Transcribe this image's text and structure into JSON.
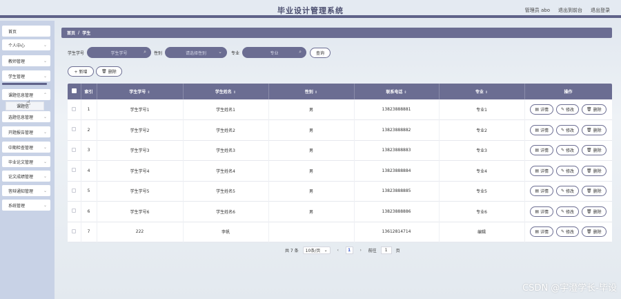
{
  "header": {
    "title": "毕业设计管理系统",
    "links": [
      "管理员 abo",
      "退出到前台",
      "退出登录"
    ]
  },
  "sidebar": {
    "items": [
      {
        "label": "首页",
        "chevron": false
      },
      {
        "label": "个人中心",
        "chevron": true
      },
      {
        "label": "教师管理",
        "chevron": true
      },
      {
        "label": "学生管理",
        "chevron": true
      },
      {
        "label": "课题信息管理",
        "chevron": true
      },
      {
        "label": "选题信息管理",
        "chevron": true
      },
      {
        "label": "开题报告管理",
        "chevron": true
      },
      {
        "label": "中期检查管理",
        "chevron": true
      },
      {
        "label": "毕业论文管理",
        "chevron": true
      },
      {
        "label": "论文成绩管理",
        "chevron": true
      },
      {
        "label": "答辩通知管理",
        "chevron": true
      },
      {
        "label": "系统管理",
        "chevron": true
      }
    ],
    "sub_item": "课题信"
  },
  "breadcrumb": {
    "home": "首页",
    "sep": "/",
    "current": "学生"
  },
  "search": {
    "student_no_label": "学生学号",
    "student_no_placeholder": "学生学号",
    "gender_label": "性别",
    "gender_placeholder": "请选择性别",
    "major_label": "专业",
    "major_placeholder": "专业",
    "query_button": "查询"
  },
  "actions": {
    "add": "+ 新增",
    "delete": "删除"
  },
  "table": {
    "headers": [
      "索引",
      "学生学号",
      "学生姓名",
      "性别",
      "联系电话",
      "专业",
      "操作"
    ],
    "rows": [
      {
        "index": "1",
        "no": "学生学号1",
        "name": "学生姓名1",
        "gender": "男",
        "phone": "13823888881",
        "major": "专业1"
      },
      {
        "index": "2",
        "no": "学生学号2",
        "name": "学生姓名2",
        "gender": "男",
        "phone": "13823888882",
        "major": "专业2"
      },
      {
        "index": "3",
        "no": "学生学号3",
        "name": "学生姓名3",
        "gender": "男",
        "phone": "13823888883",
        "major": "专业3"
      },
      {
        "index": "4",
        "no": "学生学号4",
        "name": "学生姓名4",
        "gender": "男",
        "phone": "13823888884",
        "major": "专业4"
      },
      {
        "index": "5",
        "no": "学生学号5",
        "name": "学生姓名5",
        "gender": "男",
        "phone": "13823888885",
        "major": "专业5"
      },
      {
        "index": "6",
        "no": "学生学号6",
        "name": "学生姓名6",
        "gender": "男",
        "phone": "13823888886",
        "major": "专业6"
      },
      {
        "index": "7",
        "no": "222",
        "name": "李帆",
        "gender": "",
        "phone": "13612814714",
        "major": "编辑"
      }
    ],
    "ops": {
      "detail": "详情",
      "edit": "修改",
      "delete": "删除"
    }
  },
  "pagination": {
    "total": "共 7 条",
    "page_size": "10条/页",
    "current": "1",
    "goto_label": "前往",
    "goto_value": "1",
    "page_suffix": "页"
  },
  "watermark": "CSDN @宇澄学长-毕设",
  "colors": {
    "accent": "#6b6d92",
    "sidebar_bg": "#c8d2e6"
  }
}
